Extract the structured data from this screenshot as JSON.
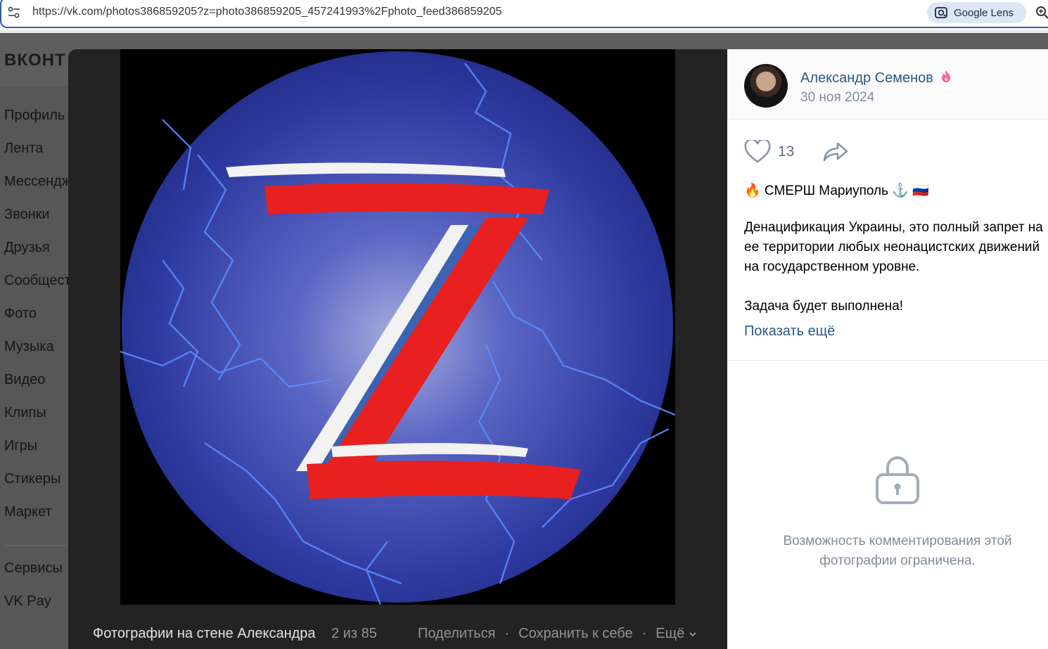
{
  "browser": {
    "url": "https://vk.com/photos386859205?z=photo386859205_457241993%2Fphoto_feed386859205",
    "lens_label": "Google Lens"
  },
  "vk": {
    "logo": "ВКОНТ",
    "nav": [
      "Профиль",
      "Лента",
      "Мессендж",
      "Звонки",
      "Друзья",
      "Сообщест",
      "Фото",
      "Музыка",
      "Видео",
      "Клипы",
      "Игры",
      "Стикеры",
      "Маркет"
    ],
    "nav2": [
      "Сервисы",
      "VK Pay"
    ]
  },
  "viewer": {
    "album_title": "Фотографии на стене Александра",
    "counter": "2 из 85",
    "share": "Поделиться",
    "save": "Сохранить к себе",
    "more": "Ещё",
    "separator": "·"
  },
  "post": {
    "author": "Александр Семенов",
    "date": "30 ноя 2024",
    "likes": "13",
    "title": "🔥 СМЕРШ Мариуполь ⚓ 🇷🇺",
    "text": "Денацификация Украины, это полный запрет на ее территории любых неонацистских движений на государственном уровне.\n\nЗадача будет выполнена!",
    "show_more": "Показать ещё",
    "comments_restricted": "Возможность комментирования этой фотографии ограничена."
  },
  "colors": {
    "link": "#2a5885",
    "muted": "#818c99",
    "viewer_bg": "#232323",
    "flag_white": "#f2f2f2",
    "flag_blue": "#3b63b4",
    "flag_red": "#e8201f"
  },
  "icons": {
    "tune": "tune-icon",
    "lens": "google-lens-icon",
    "zoom": "zoom-icon",
    "like": "heart-icon",
    "share": "share-arrow-icon",
    "lock": "lock-icon",
    "more": "chevron-down-icon"
  }
}
